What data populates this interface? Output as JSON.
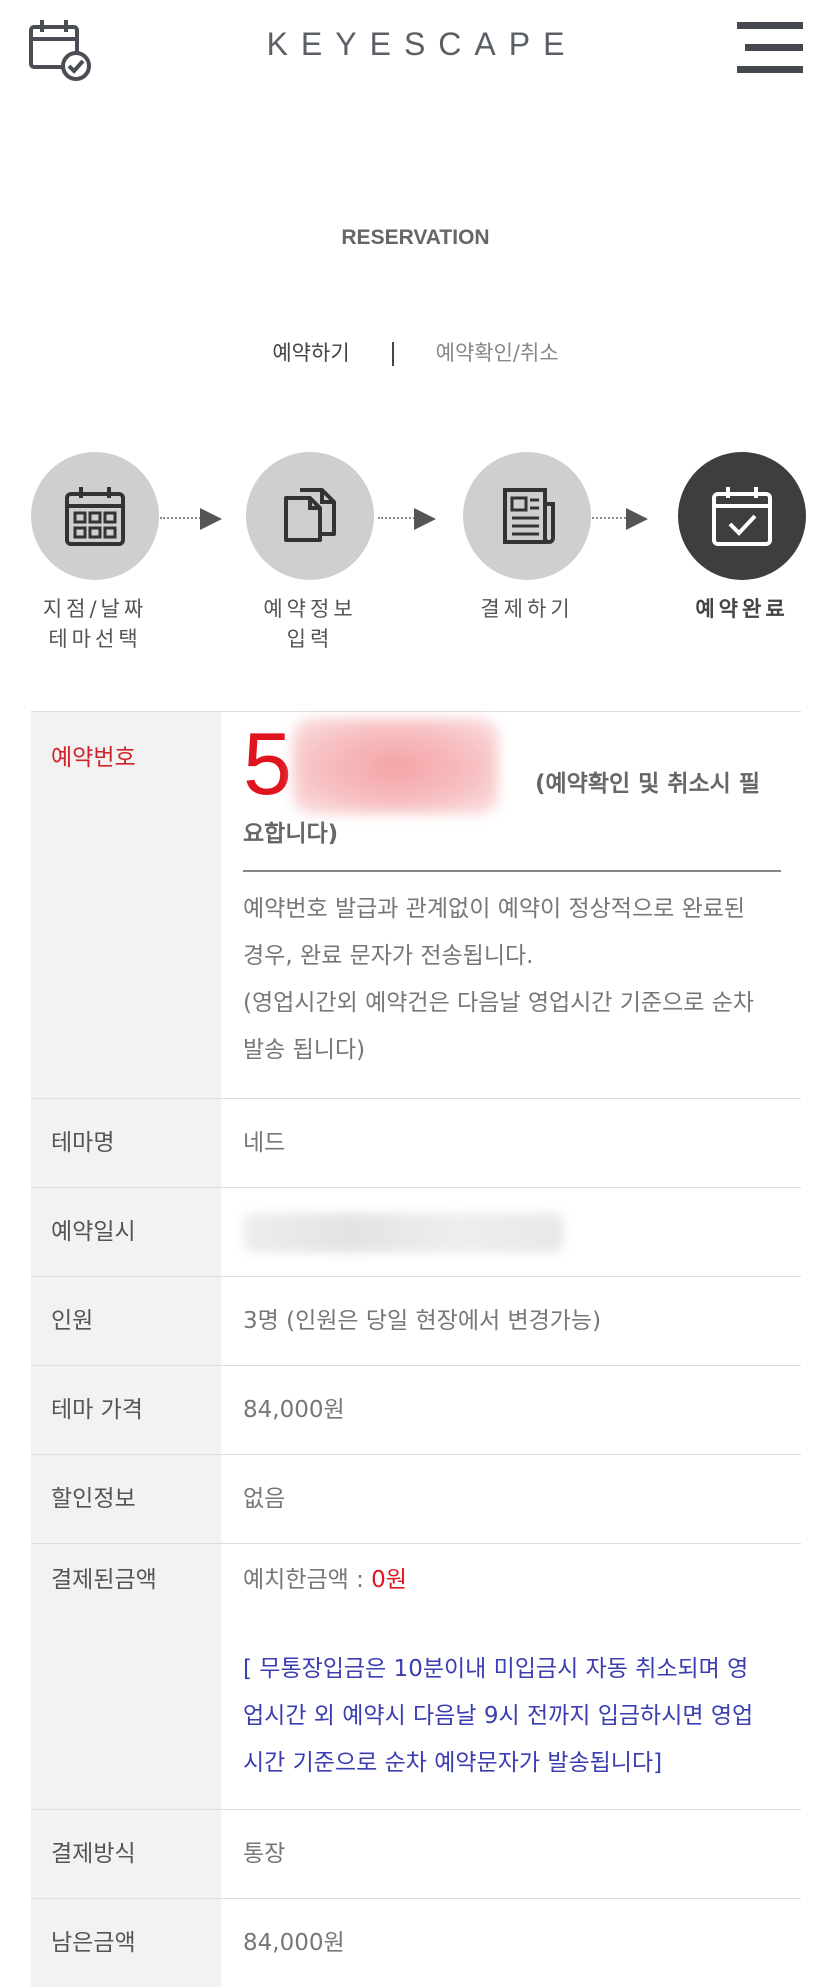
{
  "header": {
    "brand": "KEYESCAPE"
  },
  "section": {
    "title": "RESERVATION"
  },
  "subtabs": [
    {
      "label": "예약하기"
    },
    {
      "label": "예약확인/취소"
    }
  ],
  "steps": [
    {
      "label1": "지점/날짜",
      "label2": "테마선택"
    },
    {
      "label1": "예약정보",
      "label2": "입력"
    },
    {
      "label1": "결제하기",
      "label2": ""
    },
    {
      "label1": "예약완료",
      "label2": ""
    }
  ],
  "table": {
    "reservation": {
      "label": "예약번호",
      "number_prefix": "5",
      "note_part1": "(예약확인 및 취소시 필",
      "note_part2": "요합니다)",
      "desc1": "예약번호 발급과 관계없이 예약이 정상적으로 완료된",
      "desc2": "경우, 완료 문자가 전송됩니다.",
      "desc3": "(영업시간외 예약건은 다음날 영업시간 기준으로 순차",
      "desc4": "발송 됩니다)"
    },
    "theme": {
      "label": "테마명",
      "value": "네드"
    },
    "datetime": {
      "label": "예약일시"
    },
    "people": {
      "label": "인원",
      "value": "3명 (인원은 당일 현장에서 변경가능)"
    },
    "price": {
      "label": "테마 가격",
      "value": "84,000원"
    },
    "discount": {
      "label": "할인정보",
      "value": "없음"
    },
    "paid": {
      "label": "결제된금액",
      "deposit_label": "예치한금액 : ",
      "deposit_value": "0원",
      "notice1": "[ 무통장입금은 10분이내 미입금시 자동 취소되며 영",
      "notice2": "업시간 외 예약시 다음날 9시 전까지 입금하시면 영업",
      "notice3": "시간 기준으로 순차 예약문자가 발송됩니다]"
    },
    "method": {
      "label": "결제방식",
      "value": "통장"
    },
    "remaining": {
      "label": "남은금액",
      "value": "84,000원"
    }
  },
  "colors": {
    "accent_red": "#e0141e",
    "notice_blue": "#3a3eb0",
    "active_step": "#3e3e40"
  }
}
